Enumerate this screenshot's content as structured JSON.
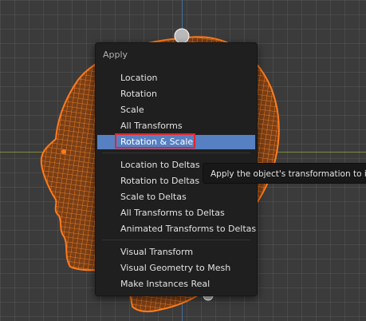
{
  "menu": {
    "title": "Apply",
    "items": [
      {
        "label": "Location"
      },
      {
        "label": "Rotation"
      },
      {
        "label": "Scale"
      },
      {
        "label": "All Transforms"
      },
      {
        "label": "Rotation & Scale",
        "active": true
      },
      {
        "label": "Location to Deltas"
      },
      {
        "label": "Rotation to Deltas"
      },
      {
        "label": "Scale to Deltas"
      },
      {
        "label": "All Transforms to Deltas"
      },
      {
        "label": "Animated Transforms to Deltas"
      },
      {
        "label": "Visual Transform"
      },
      {
        "label": "Visual Geometry to Mesh"
      },
      {
        "label": "Make Instances Real"
      }
    ]
  },
  "tooltip": {
    "text": "Apply the object's transformation to its"
  },
  "colors": {
    "menu_bg": "#1f1f1f",
    "active_item": "#5680c2",
    "highlight_outline": "#e3262b",
    "mesh_wire": "#ff7b1c",
    "x_axis": "#7c8f3a",
    "y_axis": "#3f6fa0"
  }
}
